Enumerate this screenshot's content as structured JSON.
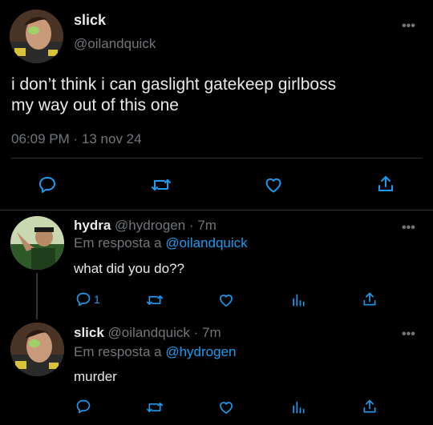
{
  "main_tweet": {
    "display_name": "slick",
    "handle": "@oilandquick",
    "text_line1": "i don’t think i can gaslight gatekeep girlboss",
    "text_line2": "my way out of this one",
    "time": "06:09 PM",
    "separator": "·",
    "date": "13 nov 24"
  },
  "reply1": {
    "display_name": "hydra",
    "handle": "@hydrogen",
    "separator": "·",
    "age": "7m",
    "replying_prefix": "Em resposta a",
    "replying_to": "@oilandquick",
    "text": "what did you do??",
    "reply_count": "1"
  },
  "reply2": {
    "display_name": "slick",
    "handle": "@oilandquick",
    "separator": "·",
    "age": "7m",
    "replying_prefix": "Em resposta a",
    "replying_to": "@hydrogen",
    "text": "murder"
  },
  "icons": {
    "more": "more-horizontal-icon",
    "reply": "reply-icon",
    "retweet": "retweet-icon",
    "like": "heart-icon",
    "share": "share-icon",
    "stats": "bar-chart-icon"
  },
  "colors": {
    "background": "#000000",
    "text": "#e7e9ea",
    "muted": "#71767b",
    "link": "#1d9bf0",
    "divider": "#2f3336"
  }
}
